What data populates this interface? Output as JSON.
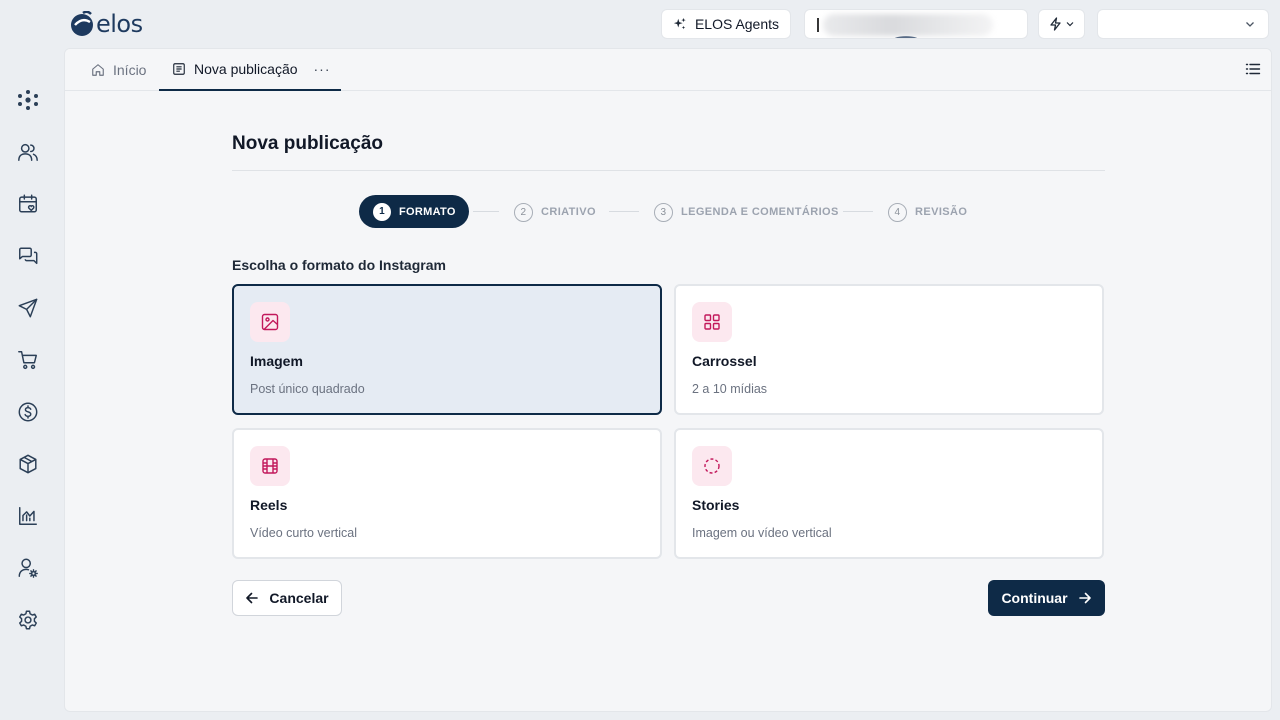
{
  "app": {
    "brand": "elos"
  },
  "topbar": {
    "agents_label": "ELOS Agents",
    "select_value": ""
  },
  "sidebar": {
    "items": [
      {
        "icon": "network-icon"
      },
      {
        "icon": "users-icon"
      },
      {
        "icon": "calendar-heart-icon"
      },
      {
        "icon": "messages-icon"
      },
      {
        "icon": "send-icon"
      },
      {
        "icon": "cart-icon"
      },
      {
        "icon": "dollar-icon"
      },
      {
        "icon": "box-icon"
      },
      {
        "icon": "chart-icon"
      },
      {
        "icon": "user-settings-icon"
      },
      {
        "icon": "gear-icon"
      }
    ]
  },
  "tabs": {
    "home": "Início",
    "active": "Nova publicação",
    "more": "···"
  },
  "page": {
    "title": "Nova publicação",
    "section_label": "Escolha o formato do Instagram"
  },
  "stepper": {
    "steps": [
      {
        "num": "1",
        "label": "FORMATO",
        "active": true
      },
      {
        "num": "2",
        "label": "CRIATIVO",
        "active": false
      },
      {
        "num": "3",
        "label": "LEGENDA E COMENTÁRIOS",
        "active": false
      },
      {
        "num": "4",
        "label": "REVISÃO",
        "active": false
      }
    ]
  },
  "formats": [
    {
      "name": "Imagem",
      "desc": "Post único quadrado",
      "icon": "image-icon",
      "selected": true
    },
    {
      "name": "Carrossel",
      "desc": "2 a 10 mídias",
      "icon": "grid-icon",
      "selected": false
    },
    {
      "name": "Reels",
      "desc": "Vídeo curto vertical",
      "icon": "film-icon",
      "selected": false
    },
    {
      "name": "Stories",
      "desc": "Imagem ou vídeo vertical",
      "icon": "circle-dashed-icon",
      "selected": false
    }
  ],
  "actions": {
    "cancel": "Cancelar",
    "continue": "Continuar"
  },
  "colors": {
    "primary": "#0e2a47",
    "accent_pink": "#c2185b",
    "icon_bg": "#fce8ef"
  }
}
